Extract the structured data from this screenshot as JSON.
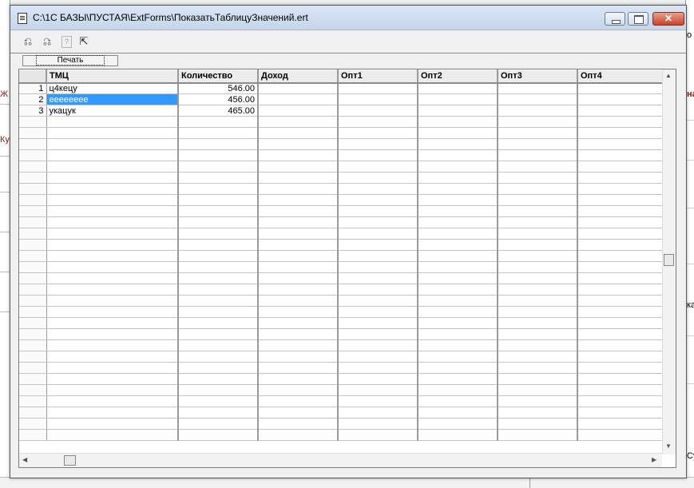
{
  "window": {
    "title": "C:\\1С БАЗЫ\\ПУСТАЯ\\ExtForms\\ПоказатьТаблицуЗначений.ert",
    "close_glyph": "✕"
  },
  "toolbar": {
    "icons": [
      "undo-save-icon",
      "redo-save-icon",
      "help-icon",
      "context-help-icon"
    ],
    "glyph_1": "⎌",
    "glyph_2": "⎌",
    "glyph_3": "?",
    "glyph_4": "⇱"
  },
  "print_button": {
    "label": "Печать"
  },
  "grid": {
    "columns": [
      "ТМЦ",
      "Количество",
      "Доход",
      "Опт1",
      "Опт2",
      "Опт3",
      "Опт4"
    ],
    "rows": [
      {
        "n": "1",
        "tmc": "ц4кецу",
        "qty": "546.00"
      },
      {
        "n": "2",
        "tmc": "ееееееее",
        "qty": "456.00"
      },
      {
        "n": "3",
        "tmc": "укацук",
        "qty": "465.00"
      }
    ],
    "selected_row": 2
  },
  "background": {
    "left_fragments": [
      "Ж",
      "Ку"
    ],
    "right_fragments": [
      "о",
      "на",
      "ка",
      "Су"
    ]
  }
}
